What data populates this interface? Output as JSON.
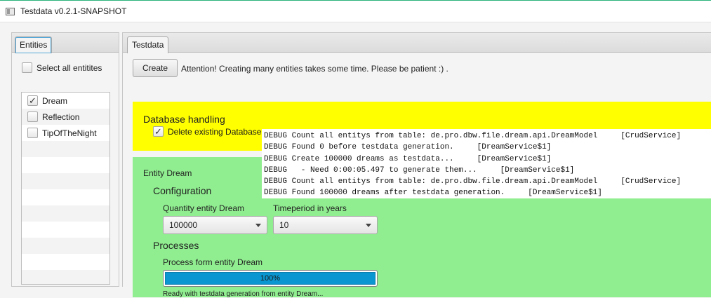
{
  "window": {
    "title": "Testdata v0.2.1-SNAPSHOT"
  },
  "left": {
    "tab_label": "Entities",
    "select_all_label": "Select all entitites",
    "select_all_checked": false,
    "items": [
      {
        "label": "Dream",
        "checked": true
      },
      {
        "label": "Reflection",
        "checked": false
      },
      {
        "label": "TipOfTheNight",
        "checked": false
      }
    ]
  },
  "right": {
    "tab_label": "Testdata",
    "create_label": "Create",
    "attention_text": "Attention! Creating many entities takes some time. Please be patient :) .",
    "db": {
      "title": "Database handling",
      "delete_label": "Delete existing Database",
      "delete_checked": true,
      "color": "#ffff00"
    },
    "entity": {
      "title": "Entity Dream",
      "color": "#90ee90",
      "config_title": "Configuration",
      "quantity_label": "Quantity entity Dream",
      "quantity_value": "100000",
      "timeperiod_label": "Timeperiod in years",
      "timeperiod_value": "10",
      "processes_title": "Processes",
      "process_label": "Process form entity Dream",
      "progress_text": "100%",
      "progress_value": 1.0,
      "progress_color": "#0a96d0",
      "ready_text": "Ready with testdata generation from entity Dream..."
    }
  },
  "log": {
    "lines": [
      "DEBUG Count all entitys from table: de.pro.dbw.file.dream.api.DreamModel     [CrudService]",
      "DEBUG Found 0 before testdata generation.     [DreamService$1]",
      "DEBUG Create 100000 dreams as testdata...     [DreamService$1]",
      "DEBUG   - Need 0:00:05.497 to generate them...     [DreamService$1]",
      "DEBUG Count all entitys from table: de.pro.dbw.file.dream.api.DreamModel     [CrudService]",
      "DEBUG Found 100000 dreams after testdata generation.     [DreamService$1]"
    ]
  }
}
